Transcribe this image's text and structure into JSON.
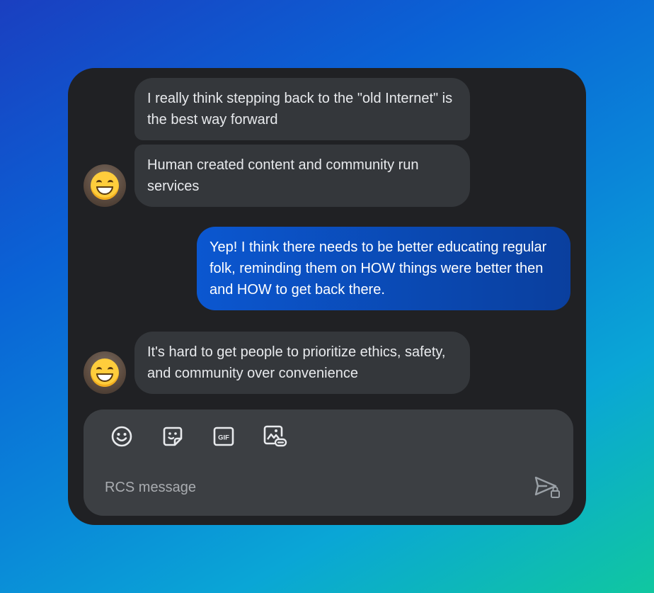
{
  "conversation": {
    "messages": [
      {
        "direction": "incoming",
        "text": "I really think stepping back to the \"old Internet\" is the best way forward"
      },
      {
        "direction": "incoming",
        "text": "Human created content and community run services"
      },
      {
        "direction": "outgoing",
        "text": "Yep! I think there needs to be better educating regular folk, reminding them on HOW things were better then and HOW to get back there."
      },
      {
        "direction": "incoming",
        "text": "It's hard to get people to prioritize ethics, safety, and community over convenience"
      }
    ]
  },
  "composer": {
    "placeholder": "RCS message",
    "tools": [
      {
        "icon": "emoji-icon"
      },
      {
        "icon": "sticker-icon"
      },
      {
        "icon": "gif-icon",
        "label": "GIF"
      },
      {
        "icon": "gallery-attach-icon"
      }
    ],
    "send_icon": "send-locked-icon"
  },
  "colors": {
    "card_background": "#202124",
    "incoming_bubble": "#34373b",
    "outgoing_bubble": "#0b57d0",
    "composer_background": "#3c3f43"
  }
}
